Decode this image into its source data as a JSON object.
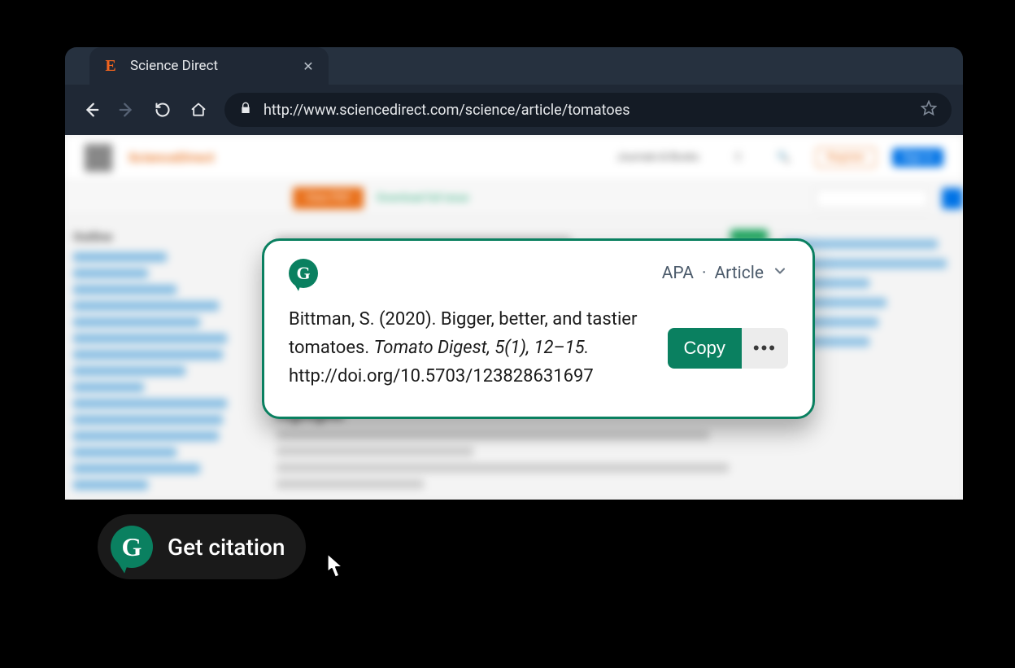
{
  "tab": {
    "favicon_letter": "E",
    "title": "Science Direct"
  },
  "address_bar": {
    "url": "http://www.sciencedirect.com/science/article/tomatoes"
  },
  "blurred_page": {
    "brand": "ScienceDirect",
    "journals_label": "Journals & Books",
    "register_label": "Register",
    "signin_label": "Sign in",
    "download_btn": "View PDF",
    "download_text": "Download full issue",
    "outline_heading": "Outline",
    "highlights_heading": "Highlights"
  },
  "citation_card": {
    "style": "APA",
    "type": "Article",
    "copy_label": "Copy",
    "more_label": "•••",
    "citation": {
      "author": "Bittman, S.",
      "year": "(2020).",
      "title": "Bigger, better, and tastier tomatoes.",
      "journal": "Tomato Digest",
      "volume_issue": ", 5(1), 12–15.",
      "doi": "http://doi.org/10.5703/123828631697"
    }
  },
  "get_citation": {
    "label": "Get citation"
  }
}
